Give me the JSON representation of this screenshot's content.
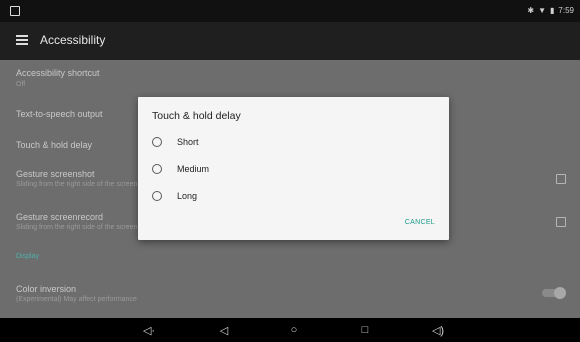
{
  "status_bar": {
    "time": "7:59"
  },
  "app_bar": {
    "title": "Accessibility"
  },
  "settings": [
    {
      "title": "Accessibility shortcut",
      "subtitle": "Off"
    },
    {
      "title": "Text-to-speech output"
    },
    {
      "title": "Touch & hold delay"
    },
    {
      "title": "Gesture screenshot",
      "subtitle": "Sliding from the right side of the screen"
    },
    {
      "title": "Gesture screenrecord",
      "subtitle": "Sliding from the right side of the screen"
    },
    {
      "section": "Display"
    },
    {
      "title": "Color inversion",
      "subtitle": "(Experimental) May affect performance"
    }
  ],
  "dialog": {
    "title": "Touch & hold delay",
    "options": [
      "Short",
      "Medium",
      "Long"
    ],
    "cancel": "CANCEL"
  },
  "icons": {
    "statusbar_left": "notification-icon",
    "statusbar_right": [
      "bluetooth-icon",
      "wifi-icon",
      "battery-icon"
    ],
    "navbar": [
      "volume-down-icon",
      "back-icon",
      "home-icon",
      "recents-icon",
      "volume-up-icon"
    ]
  },
  "colors": {
    "accent": "#1b9a8a",
    "dim_overlay_list": "#6d6d6d",
    "app_bar": "#1f1f1f",
    "dialog_bg": "#f5f5f5"
  }
}
